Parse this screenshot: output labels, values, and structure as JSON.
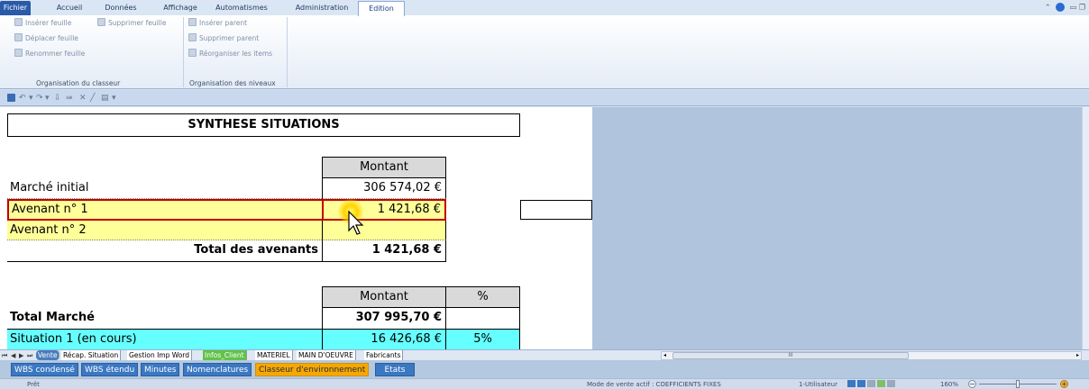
{
  "ribbon_tabs": [
    {
      "label": "Fichier",
      "left": 0
    },
    {
      "label": "Accueil"
    },
    {
      "label": "Données"
    },
    {
      "label": "Affichage"
    },
    {
      "label": "Automatismes"
    },
    {
      "label": "Administration"
    },
    {
      "label": "Edition"
    }
  ],
  "ribbon": {
    "btn_insert_sheet": "Insérer feuille",
    "btn_delete_sheet": "Supprimer feuille",
    "btn_move_sheet": "Déplacer feuille",
    "btn_rename_sheet": "Renommer feuille",
    "group_workbook": "Organisation du classeur",
    "btn_insert_parent": "Insérer parent",
    "btn_delete_parent": "Supprimer parent",
    "btn_reorganize": "Réorganiser les items",
    "group_levels": "Organisation des niveaux"
  },
  "sheet": {
    "title": "SYNTHESE SITUATIONS",
    "header_amount": "Montant",
    "rows1": {
      "initial_label": "Marché initial",
      "initial_value": "306 574,02 €",
      "av1_label": "Avenant n° 1",
      "av1_value": "1 421,68 €",
      "av2_label": "Avenant n° 2",
      "av2_value": "",
      "total_label": "Total des avenants",
      "total_value": "1 421,68 €"
    },
    "header_amount2": "Montant",
    "header_pct": "%",
    "rows2": {
      "total_market_label": "Total Marché",
      "total_market_value": "307 995,70 €",
      "situation_label": "Situation 1 (en cours)",
      "situation_value": "16 426,68 €",
      "situation_pct": "5%"
    }
  },
  "sheet_tabs": {
    "tabs": [
      "Vente",
      "Récap. Situation",
      "Gestion Imp Word",
      "Infos_Client",
      "MATERIEL",
      "MAIN D'OEUVRE",
      "Fabricants"
    ],
    "scroll_grip": "III"
  },
  "bottom_buttons": {
    "wbs_condense": "WBS condensé",
    "wbs_etendu": "WBS étendu",
    "minutes": "Minutes",
    "nomenclatures": "Nomenclatures",
    "classeur": "Classeur d'environnement",
    "etats": "Etats"
  },
  "status": {
    "ready": "Prêt",
    "mode": "Mode de vente actif : COEFFICIENTS FIXES",
    "user": "1-Utilisateur",
    "zoom": "160%"
  },
  "colors": {
    "highlight_yellow": "#ffff99",
    "selection_red": "#c00000",
    "cyan_row": "#66ffff",
    "active_button": "#f7a800"
  }
}
